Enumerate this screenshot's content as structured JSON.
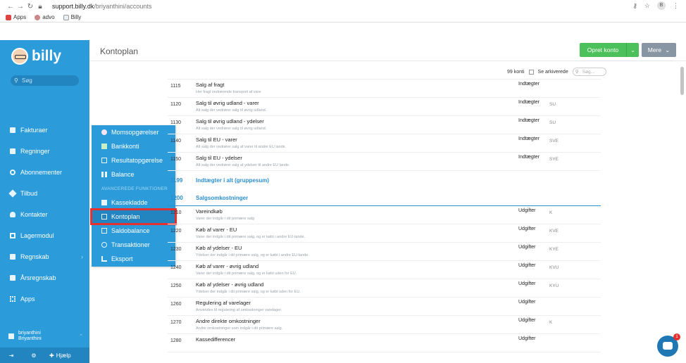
{
  "browser": {
    "url_host": "support.billy.dk",
    "url_path": "/briyanthini/accounts",
    "profile_initial": "B",
    "bookmarks": [
      {
        "label": "Apps",
        "color": "#d44"
      },
      {
        "label": "advo",
        "color": "#c88"
      },
      {
        "label": "Billy",
        "color": "#2b9bd9"
      }
    ]
  },
  "sidebar": {
    "logo": "billy",
    "search_placeholder": "Søg",
    "items": [
      {
        "label": "Fakturaer"
      },
      {
        "label": "Regninger"
      },
      {
        "label": "Abonnementer"
      },
      {
        "label": "Tilbud"
      },
      {
        "label": "Kontakter"
      },
      {
        "label": "Lagermodul"
      },
      {
        "label": "Regnskab"
      },
      {
        "label": "Årsregnskab"
      },
      {
        "label": "Apps"
      }
    ],
    "user_name": "briyanthini",
    "user_org": "Briyanthini",
    "help_label": "Hjælp"
  },
  "flyout": {
    "items": [
      {
        "label": "Momsopgørelser"
      },
      {
        "label": "Bankkonti"
      },
      {
        "label": "Resultatopgørelse"
      },
      {
        "label": "Balance"
      }
    ],
    "section": "AVANCEREDE FUNKTIONER",
    "advanced": [
      {
        "label": "Kassekladde"
      },
      {
        "label": "Kontoplan"
      },
      {
        "label": "Saldobalance"
      },
      {
        "label": "Transaktioner"
      },
      {
        "label": "Eksport"
      }
    ]
  },
  "header": {
    "title": "Kontoplan",
    "create_label": "Opret konto",
    "more_label": "Mere"
  },
  "toolbar": {
    "count_label": "99 konti",
    "archived_label": "Se arkiverede",
    "search_placeholder": "Søg..."
  },
  "accounts_top": [
    {
      "num": "1115",
      "name": "Salg af fragt",
      "desc": "Her fragt vedrørende transport af vare",
      "type": "Indtægter",
      "vat": ""
    },
    {
      "num": "1120",
      "name": "Salg til øvrig udland - varer",
      "desc": "Alt salg der vedrører salg til øvrig udland.",
      "type": "Indtægter",
      "vat": "SU"
    },
    {
      "num": "1130",
      "name": "Salg til øvrig udland - ydelser",
      "desc": "Alt salg der vedrører salg til øvrig udland.",
      "type": "Indtægter",
      "vat": "SU"
    },
    {
      "num": "1140",
      "name": "Salg til EU - varer",
      "desc": "Alt salg der vedrører salg af varer til andre EU lande.",
      "type": "Indtægter",
      "vat": "SVE"
    },
    {
      "num": "1150",
      "name": "Salg til EU - ydelser",
      "desc": "Alt salg der vedrører salg af ydelser til andre EU lande.",
      "type": "Indtægter",
      "vat": "SYE"
    }
  ],
  "group_sum": {
    "num": "1199",
    "name": "Indtægter i alt (gruppesum)"
  },
  "group_header": {
    "num": "1200",
    "name": "Salgsomkostninger"
  },
  "accounts_bottom": [
    {
      "num": "1210",
      "name": "Vareindkøb",
      "desc": "Varer der indgår i dit primære salg",
      "type": "Udgifter",
      "vat": "K"
    },
    {
      "num": "1220",
      "name": "Køb af varer - EU",
      "desc": "Varer der indgår i dit primære salg, og er købt i andre EU-lande.",
      "type": "Udgifter",
      "vat": "KVE"
    },
    {
      "num": "1230",
      "name": "Køb af ydelser - EU",
      "desc": "Ydelser der indgår i dit primære salg, og er købt i andre EU-lande.",
      "type": "Udgifter",
      "vat": "KYE"
    },
    {
      "num": "1240",
      "name": "Køb af varer - øvrig udland",
      "desc": "Varer der indgår i dit primære salg, og er købt uden for EU.",
      "type": "Udgifter",
      "vat": "KVU"
    },
    {
      "num": "1250",
      "name": "Køb af ydelser - øvrig udland",
      "desc": "Ydelser der indgår i dit primære salg, og er købt uden for EU.",
      "type": "Udgifter",
      "vat": "KYU"
    },
    {
      "num": "1260",
      "name": "Regulering af varelager",
      "desc": "Anvendes til regulering af omkostninger varelager.",
      "type": "Udgifter",
      "vat": ""
    },
    {
      "num": "1270",
      "name": "Andre direkte omkostninger",
      "desc": "Andre omkostninger som indgår i dit primære salg.",
      "type": "Udgifter",
      "vat": "K"
    },
    {
      "num": "1280",
      "name": "Kassedifferencer",
      "desc": "",
      "type": "Udgifter",
      "vat": ""
    }
  ],
  "chat_badge": "1",
  "colors": {
    "accent": "#2b9bd9",
    "create": "#4cc05a",
    "more": "#8896a3",
    "highlight": "#e53030"
  }
}
